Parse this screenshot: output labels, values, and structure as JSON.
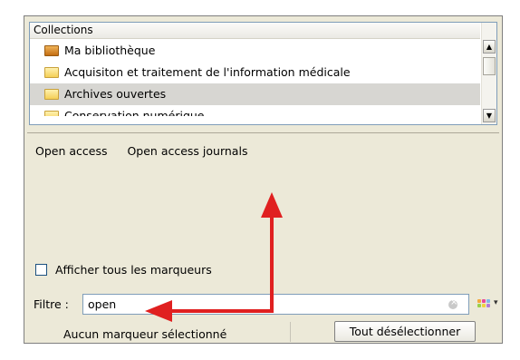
{
  "collections": {
    "header": "Collections",
    "items": [
      {
        "label": "Ma bibliothèque",
        "icon": "library-icon",
        "selected": false
      },
      {
        "label": "Acquisiton et traitement de l'information médicale",
        "icon": "folder-icon",
        "selected": false
      },
      {
        "label": "Archives ouvertes",
        "icon": "folder-icon",
        "selected": true
      },
      {
        "label": "Conservation numérique",
        "icon": "folder-icon",
        "selected": false
      }
    ]
  },
  "tags": {
    "items": [
      "Open access",
      "Open access journals"
    ]
  },
  "show_all": {
    "label": "Afficher tous les marqueurs",
    "checked": false
  },
  "filter": {
    "label": "Filtre :",
    "value": "open"
  },
  "status": {
    "text": "Aucun marqueur sélectionné"
  },
  "deselect_button": {
    "label": "Tout désélectionner"
  },
  "colors": {
    "annotation_arrow": "#e02020",
    "selection": "#d7d6d2",
    "panel_background": "#ece9d8"
  }
}
